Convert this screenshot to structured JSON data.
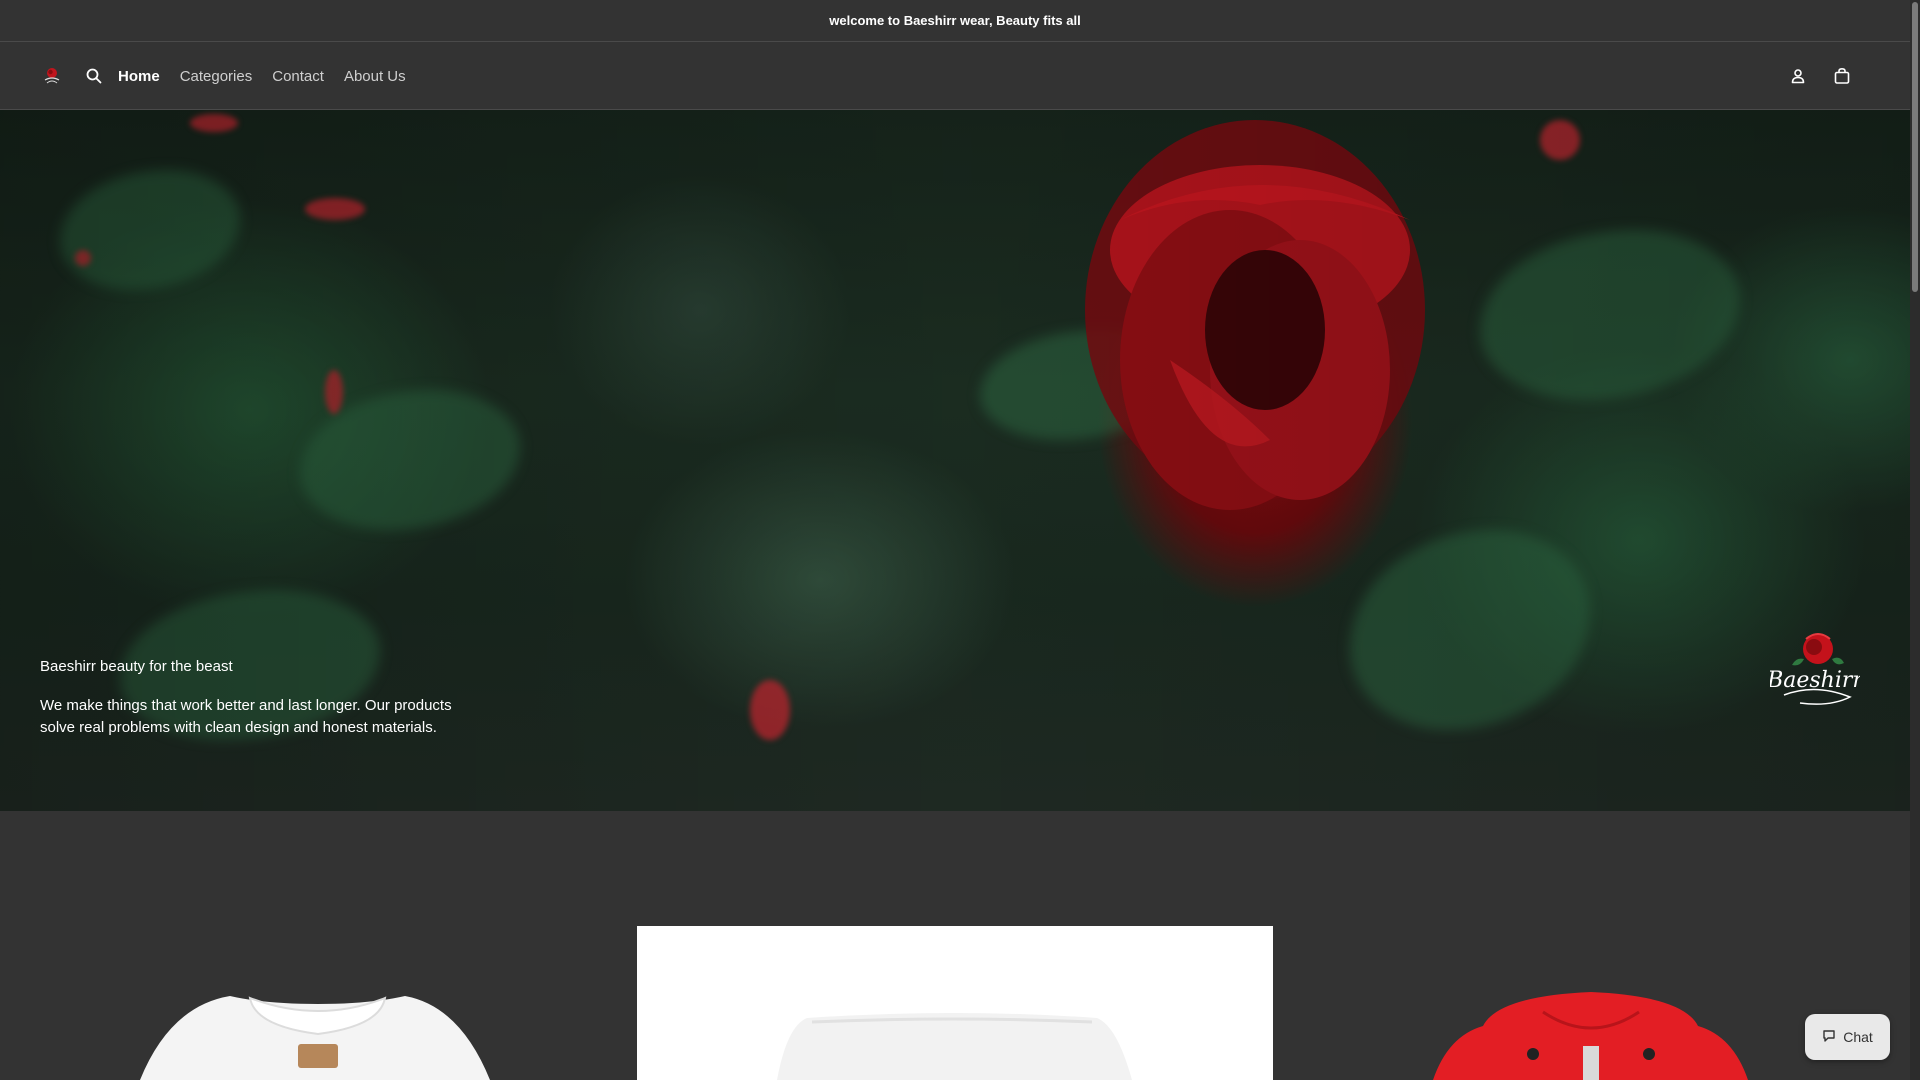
{
  "announcement": {
    "text": "welcome to Baeshirr wear, Beauty fits all"
  },
  "header": {
    "logo_alt": "Baeshirr",
    "nav": [
      {
        "label": "Home",
        "active": true
      },
      {
        "label": "Categories",
        "active": false
      },
      {
        "label": "Contact",
        "active": false
      },
      {
        "label": "About Us",
        "active": false
      }
    ],
    "icons": [
      "search-icon",
      "account-icon",
      "cart-icon"
    ]
  },
  "hero": {
    "tagline": "Baeshirr beauty for the beast",
    "description": "We make things that work better and last longer. Our products solve real problems with clean design and honest materials.",
    "logo_text": "Baeshirr"
  },
  "products": [
    {
      "image": "white-shirt"
    },
    {
      "image": "white-shorts"
    },
    {
      "image": "red-hoodie"
    }
  ],
  "chat": {
    "label": "Chat"
  },
  "colors": {
    "background": "#333333",
    "rose": "#b0121a",
    "leaf": "#2f6b45",
    "hoodie": "#e31e24"
  }
}
